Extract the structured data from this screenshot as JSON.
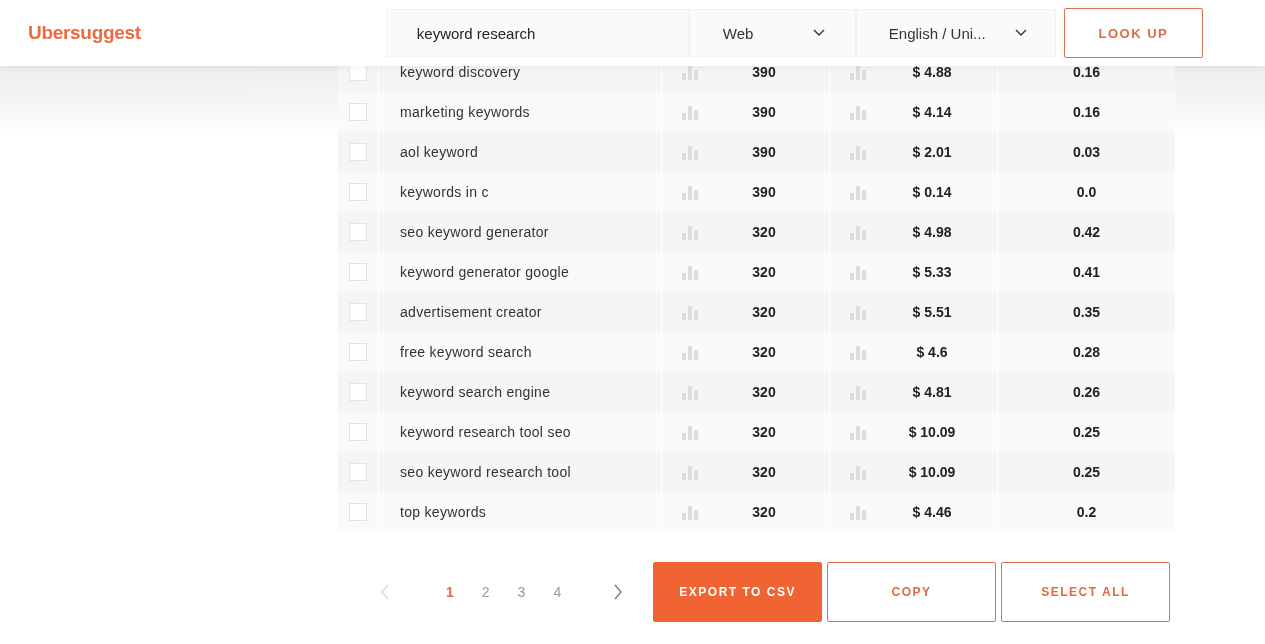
{
  "header": {
    "logo": "Ubersuggest",
    "search": {
      "value": "keyword research"
    },
    "platform": "Web",
    "language": "English / Uni...",
    "lookup_button": "LOOK UP"
  },
  "table": {
    "rows": [
      {
        "checked": false,
        "keyword": "keyword discovery",
        "volume": "390",
        "cpc": "$ 4.88",
        "sd": "0.16"
      },
      {
        "checked": false,
        "keyword": "marketing keywords",
        "volume": "390",
        "cpc": "$ 4.14",
        "sd": "0.16"
      },
      {
        "checked": false,
        "keyword": "aol keyword",
        "volume": "390",
        "cpc": "$ 2.01",
        "sd": "0.03"
      },
      {
        "checked": false,
        "keyword": "keywords in c",
        "volume": "390",
        "cpc": "$ 0.14",
        "sd": "0.0"
      },
      {
        "checked": false,
        "keyword": "seo keyword generator",
        "volume": "320",
        "cpc": "$ 4.98",
        "sd": "0.42"
      },
      {
        "checked": false,
        "keyword": "keyword generator google",
        "volume": "320",
        "cpc": "$ 5.33",
        "sd": "0.41"
      },
      {
        "checked": false,
        "keyword": "advertisement creator",
        "volume": "320",
        "cpc": "$ 5.51",
        "sd": "0.35"
      },
      {
        "checked": false,
        "keyword": "free keyword search",
        "volume": "320",
        "cpc": "$ 4.6",
        "sd": "0.28"
      },
      {
        "checked": false,
        "keyword": "keyword search engine",
        "volume": "320",
        "cpc": "$ 4.81",
        "sd": "0.26"
      },
      {
        "checked": false,
        "keyword": "keyword research tool seo",
        "volume": "320",
        "cpc": "$ 10.09",
        "sd": "0.25"
      },
      {
        "checked": false,
        "keyword": "seo keyword research tool",
        "volume": "320",
        "cpc": "$ 10.09",
        "sd": "0.25"
      },
      {
        "checked": false,
        "keyword": "top keywords",
        "volume": "320",
        "cpc": "$ 4.46",
        "sd": "0.2"
      }
    ]
  },
  "pagination": {
    "prev_disabled": true,
    "pages": [
      {
        "label": "1",
        "selected": true
      },
      {
        "label": "2",
        "selected": false
      },
      {
        "label": "3",
        "selected": false
      },
      {
        "label": "4",
        "selected": false
      }
    ]
  },
  "actions": [
    {
      "label": "EXPORT TO CSV",
      "kind": "primary"
    },
    {
      "label": "COPY",
      "kind": "outline"
    },
    {
      "label": "SELECT ALL",
      "kind": "outline"
    }
  ]
}
